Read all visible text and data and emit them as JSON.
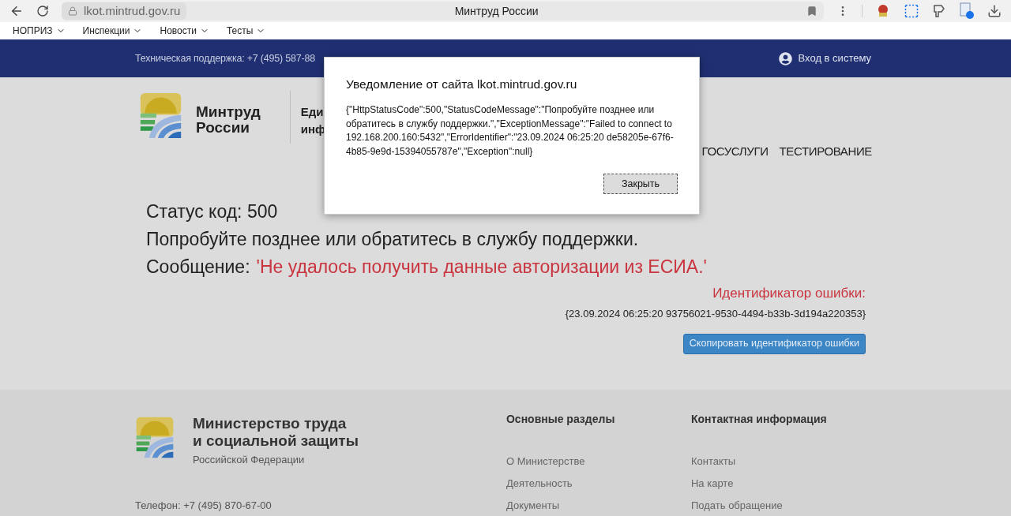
{
  "browser": {
    "url": "lkot.mintrud.gov.ru",
    "tab_title": "Минтруд России",
    "bookmarks": [
      "НОПРИЗ",
      "Инспекции",
      "Новости",
      "Тесты"
    ]
  },
  "top_bar": {
    "support": "Техническая поддержка: +7 (495) 587-88",
    "login": "Вход в систему"
  },
  "header": {
    "logo_text": [
      "Минтруд",
      "России"
    ],
    "title_fragment": [
      "Еди",
      "инф"
    ],
    "nav": [
      "ГОСУСЛУГИ",
      "ТЕСТИРОВАНИЕ"
    ]
  },
  "error": {
    "status": "Статус код: 500",
    "advice": "Попробуйте позднее или обратитесь в службу поддержки.",
    "message_label": "Сообщение:",
    "message": "'Не удалось получить данные авторизации из ЕСИА.'",
    "id_label": "Идентификатор ошибки:",
    "id": "{23.09.2024 06:25:20 93756021-9530-4494-b33b-3d194a220353}",
    "copy_button": "Скопировать идентификатор ошибки"
  },
  "dialog": {
    "title": "Уведомление от сайта lkot.mintrud.gov.ru",
    "body": "{\"HttpStatusCode\":500,\"StatusCodeMessage\":\"Попробуйте позднее или обратитесь в службу поддержки.\",\"ExceptionMessage\":\"Failed to connect to 192.168.200.160:5432\",\"ErrorIdentifier\":\"23.09.2024 06:25:20 de58205e-67f6-4b85-9e9d-15394055787e\",\"Exception\":null}",
    "button": "Закрыть"
  },
  "footer": {
    "org_title": [
      "Министерство труда",
      "и социальной защиты"
    ],
    "org_subtitle": "Российской Федерации",
    "phone": "Телефон: +7 (495) 870-67-00",
    "columns": [
      {
        "heading": "Основные разделы",
        "links": [
          "О Министерстве",
          "Деятельность",
          "Документы"
        ]
      },
      {
        "heading": "Контактная информация",
        "links": [
          "Контакты",
          "На карте",
          "Подать обращение"
        ]
      }
    ]
  }
}
